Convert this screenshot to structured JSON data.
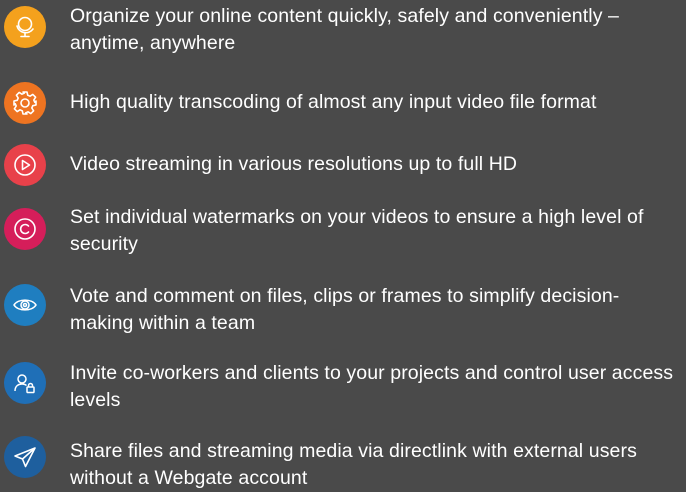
{
  "features": [
    {
      "text": "Organize your online content quickly, safely and conveniently – anytime, anywhere",
      "icon": "globe-icon",
      "color": "#f4a11d"
    },
    {
      "text": "High quality transcoding of almost any input video file format",
      "icon": "gear-icon",
      "color": "#ee7421"
    },
    {
      "text": "Video streaming in various resolutions up to full HD",
      "icon": "play-icon",
      "color": "#e8414a"
    },
    {
      "text": "Set individual watermarks on your videos to ensure a high level of security",
      "icon": "copyright-icon",
      "color": "#d51e5a"
    },
    {
      "text": "Vote and comment on files, clips or frames to simplify decision-making within a team",
      "icon": "eye-icon",
      "color": "#1f7ec0"
    },
    {
      "text": "Invite co-workers and clients to your projects and control user access levels",
      "icon": "user-lock-icon",
      "color": "#1f6fb7"
    },
    {
      "text": "Share files and streaming media via directlink with external users without a Webgate account",
      "icon": "send-icon",
      "color": "#1e5f9e"
    }
  ]
}
